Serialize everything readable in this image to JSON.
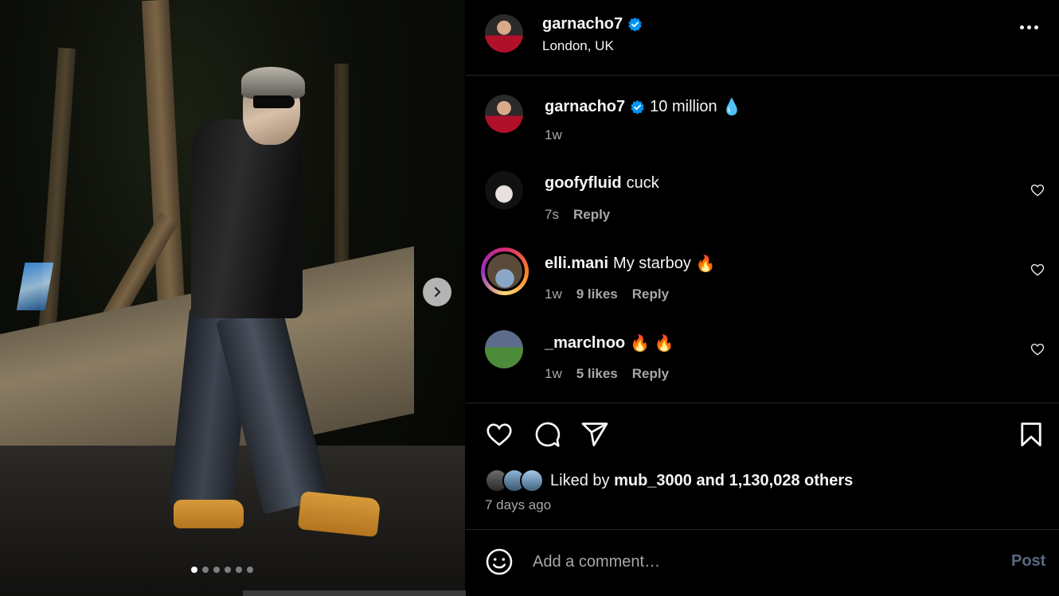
{
  "post": {
    "username": "garnacho7",
    "location": "London, UK",
    "carousel": {
      "total_slides": 6,
      "active_slide": 1
    }
  },
  "caption": {
    "username": "garnacho7",
    "text": "10 million",
    "emoji": "💧",
    "time": "1w"
  },
  "comments": [
    {
      "username": "goofyfluid",
      "text": "cuck",
      "time": "7s",
      "likes": "",
      "reply": "Reply"
    },
    {
      "username": "elli.mani",
      "text": "My starboy",
      "emoji": "🔥",
      "time": "1w",
      "likes": "9 likes",
      "reply": "Reply"
    },
    {
      "username": "_marclnoo",
      "text": "",
      "emoji": "🔥 🔥",
      "time": "1w",
      "likes": "5 likes",
      "reply": "Reply"
    }
  ],
  "likes": {
    "prefix": "Liked by",
    "user": "mub_3000",
    "middle": "and",
    "others": "1,130,028 others"
  },
  "posted_ago": "7 days ago",
  "composer": {
    "placeholder": "Add a comment…",
    "post_label": "Post"
  },
  "colors": {
    "background": "#000000",
    "verified": "#0095f6",
    "secondary_text": "#a8a8a8",
    "post_disabled": "#5a6a80"
  }
}
